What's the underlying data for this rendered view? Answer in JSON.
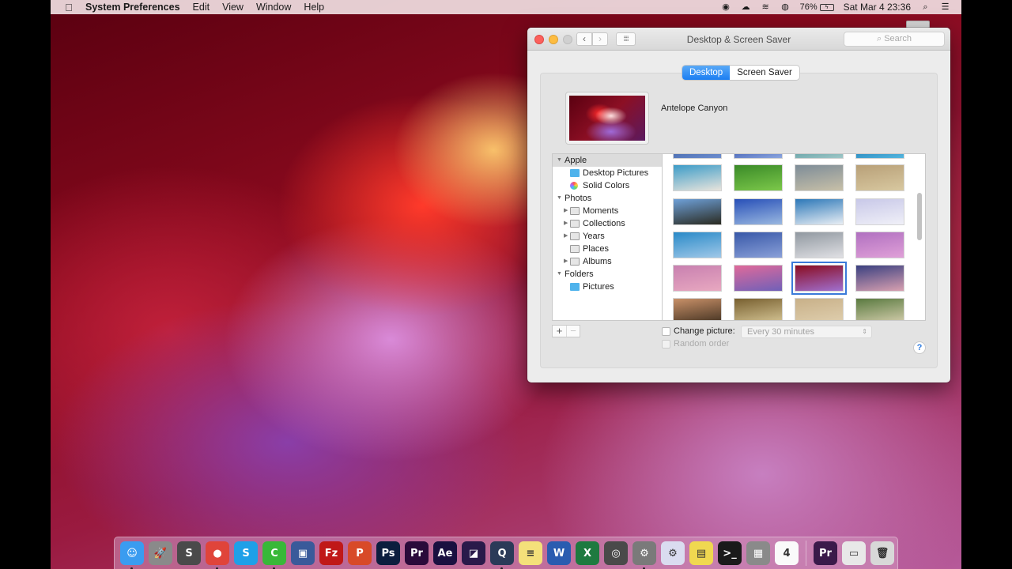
{
  "menubar": {
    "app_name": "System Preferences",
    "items": [
      "Edit",
      "View",
      "Window",
      "Help"
    ],
    "status": {
      "battery_percent": "76%",
      "clock": "Sat Mar 4  23:36"
    }
  },
  "window": {
    "title": "Desktop & Screen Saver",
    "search_placeholder": "Search",
    "tabs": [
      {
        "label": "Desktop",
        "active": true
      },
      {
        "label": "Screen Saver",
        "active": false
      }
    ],
    "current_wallpaper": "Antelope Canyon",
    "sources": [
      {
        "label": "Apple",
        "level": 0,
        "expanded": true,
        "selected": true,
        "icon": "none"
      },
      {
        "label": "Desktop Pictures",
        "level": 1,
        "icon": "folder-blue"
      },
      {
        "label": "Solid Colors",
        "level": 1,
        "icon": "color-wheel"
      },
      {
        "label": "Photos",
        "level": 0,
        "expanded": true,
        "icon": "none"
      },
      {
        "label": "Moments",
        "level": 1,
        "collapsed": true,
        "icon": "folder-gray"
      },
      {
        "label": "Collections",
        "level": 1,
        "collapsed": true,
        "icon": "folder-gray"
      },
      {
        "label": "Years",
        "level": 1,
        "collapsed": true,
        "icon": "folder-gray"
      },
      {
        "label": "Places",
        "level": 1,
        "icon": "folder-gray"
      },
      {
        "label": "Albums",
        "level": 1,
        "collapsed": true,
        "icon": "folder-gray"
      },
      {
        "label": "Folders",
        "level": 0,
        "expanded": true,
        "icon": "none"
      },
      {
        "label": "Pictures",
        "level": 1,
        "icon": "folder-blue"
      }
    ],
    "thumbnails": [
      {
        "name": "blue-strip-1",
        "colors": [
          "#3f63a8",
          "#6f8fd0"
        ]
      },
      {
        "name": "blue-strip-2",
        "colors": [
          "#3a58b0",
          "#8ea8e0"
        ]
      },
      {
        "name": "teal-strip",
        "colors": [
          "#5a9aa0",
          "#a0c8c8"
        ]
      },
      {
        "name": "ocean-strip",
        "colors": [
          "#1f7fb8",
          "#56b8e0"
        ]
      },
      {
        "name": "beach",
        "colors": [
          "#3c9cc8",
          "#e8e4dc"
        ]
      },
      {
        "name": "green-leaves",
        "colors": [
          "#3a8a28",
          "#7cc84a"
        ]
      },
      {
        "name": "abstract-gray",
        "colors": [
          "#7d8c98",
          "#c8c0a8"
        ]
      },
      {
        "name": "sand-dunes",
        "colors": [
          "#b8a078",
          "#d8c8a0"
        ]
      },
      {
        "name": "mountain-mist",
        "colors": [
          "#6ea0d8",
          "#2a2a20"
        ]
      },
      {
        "name": "blue-horizon",
        "colors": [
          "#2850b8",
          "#9ab8e0"
        ]
      },
      {
        "name": "ice-crack",
        "colors": [
          "#2c78b8",
          "#e8eef4"
        ]
      },
      {
        "name": "snow-drifts",
        "colors": [
          "#c8c8e8",
          "#f0f0f8"
        ]
      },
      {
        "name": "frozen-trees",
        "colors": [
          "#2a8ac8",
          "#a0c8e8"
        ]
      },
      {
        "name": "blue-texture",
        "colors": [
          "#3858a8",
          "#8aa0d8"
        ]
      },
      {
        "name": "foggy-lake",
        "colors": [
          "#9098a0",
          "#e0e0e4"
        ]
      },
      {
        "name": "purple-hills",
        "colors": [
          "#b070c0",
          "#e0a0d8"
        ]
      },
      {
        "name": "pink-clouds",
        "colors": [
          "#c880b0",
          "#e8a8c0"
        ]
      },
      {
        "name": "purple-mountain",
        "colors": [
          "#e06a9a",
          "#7060b8"
        ]
      },
      {
        "name": "antelope-canyon",
        "colors": [
          "#8a0c20",
          "#a070d0"
        ],
        "selected": true
      },
      {
        "name": "lake-reflection",
        "colors": [
          "#3a4080",
          "#d8a0b0"
        ]
      },
      {
        "name": "sunset-lake",
        "colors": [
          "#c89068",
          "#403020"
        ]
      },
      {
        "name": "golden-cliffs",
        "colors": [
          "#786030",
          "#d8c898"
        ]
      },
      {
        "name": "sand-plain",
        "colors": [
          "#c8b088",
          "#e0d0b0"
        ]
      },
      {
        "name": "elephant",
        "colors": [
          "#5a7a40",
          "#d8d0b0"
        ]
      }
    ],
    "change_picture": {
      "label": "Change picture:",
      "checked": false,
      "interval": "Every 30 minutes"
    },
    "random_order": {
      "label": "Random order",
      "checked": false,
      "disabled": true
    },
    "add_label": "+",
    "remove_label": "−",
    "help_label": "?"
  },
  "dock": {
    "apps": [
      {
        "name": "Finder",
        "glyph": "☺",
        "bg": "#3a9cf0",
        "running": true
      },
      {
        "name": "Launchpad",
        "glyph": "🚀",
        "bg": "#8a8a8a",
        "running": false
      },
      {
        "name": "Sublime Text",
        "glyph": "S",
        "bg": "#4a4a4a",
        "running": false
      },
      {
        "name": "Google Chrome",
        "glyph": "●",
        "bg": "#e0443a",
        "running": true
      },
      {
        "name": "Skype",
        "glyph": "S",
        "bg": "#1ea0e8",
        "running": false
      },
      {
        "name": "CleanMyMac",
        "glyph": "C",
        "bg": "#38b838",
        "running": true
      },
      {
        "name": "VirtualBox",
        "glyph": "▣",
        "bg": "#3a5a9a",
        "running": false
      },
      {
        "name": "FileZilla",
        "glyph": "Fz",
        "bg": "#c01818",
        "running": false
      },
      {
        "name": "PowerPoint",
        "glyph": "P",
        "bg": "#d84a28",
        "running": false
      },
      {
        "name": "Photoshop",
        "glyph": "Ps",
        "bg": "#0c1e3e",
        "running": false
      },
      {
        "name": "Premiere Pro",
        "glyph": "Pr",
        "bg": "#2a0a3a",
        "running": false
      },
      {
        "name": "After Effects",
        "glyph": "Ae",
        "bg": "#1a1040",
        "running": false
      },
      {
        "name": "Media Encoder",
        "glyph": "◪",
        "bg": "#2a1a4a",
        "running": false
      },
      {
        "name": "QuickTime Player",
        "glyph": "Q",
        "bg": "#2a3a58",
        "running": true
      },
      {
        "name": "Notes",
        "glyph": "≡",
        "bg": "#f4e07a",
        "running": false
      },
      {
        "name": "Word",
        "glyph": "W",
        "bg": "#2a5cb0",
        "running": false
      },
      {
        "name": "Excel",
        "glyph": "X",
        "bg": "#1e7a40",
        "running": false
      },
      {
        "name": "Digital Color Meter",
        "glyph": "◎",
        "bg": "#4a4a4a",
        "running": false
      },
      {
        "name": "System Preferences",
        "glyph": "⚙",
        "bg": "#7a7a7a",
        "running": true
      },
      {
        "name": "Automator Settings",
        "glyph": "⚙",
        "bg": "#dadcf0",
        "running": false
      },
      {
        "name": "Stickies",
        "glyph": "▤",
        "bg": "#f0d850",
        "running": false
      },
      {
        "name": "Terminal",
        "glyph": ">_",
        "bg": "#1a1a1a",
        "running": false
      },
      {
        "name": "Calculator",
        "glyph": "▦",
        "bg": "#8a8a8a",
        "running": false
      },
      {
        "name": "Calendar",
        "glyph": "4",
        "bg": "#fafafa",
        "running": false
      }
    ],
    "docs": [
      {
        "name": "Premiere Project",
        "glyph": "Pr",
        "bg": "#3a1a4a"
      },
      {
        "name": "Chrome Download",
        "glyph": "▭",
        "bg": "#e8e8e8"
      },
      {
        "name": "Trash",
        "glyph": "🗑",
        "bg": "#d8d8d8"
      }
    ]
  }
}
